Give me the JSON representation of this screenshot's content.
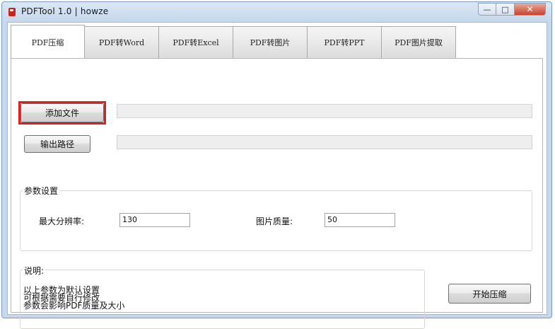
{
  "window": {
    "title": "PDFTool 1.0 | howze",
    "controls": {
      "minimize": "—",
      "maximize": "□",
      "close": "✕"
    }
  },
  "tabs": [
    {
      "label": "PDF压缩",
      "active": true
    },
    {
      "label": "PDF转Word",
      "active": false
    },
    {
      "label": "PDF转Excel",
      "active": false
    },
    {
      "label": "PDF转图片",
      "active": false
    },
    {
      "label": "PDF转PPT",
      "active": false
    },
    {
      "label": "PDF图片提取",
      "active": false
    }
  ],
  "file": {
    "add_button": "添加文件",
    "add_path": "",
    "output_button": "输出路径",
    "output_path": ""
  },
  "params": {
    "group_title": "参数设置",
    "max_resolution_label": "最大分辨率:",
    "max_resolution_value": "130",
    "image_quality_label": "图片质量:",
    "image_quality_value": "50"
  },
  "description": {
    "title": "说明:",
    "lines": [
      "以上参数为默认设置",
      "可根据需要自行修改",
      "参数会影响PDF质量及大小"
    ]
  },
  "actions": {
    "start_button": "开始压缩"
  },
  "colors": {
    "highlight": "#e0201a",
    "title_gradient": "#c6d8ec",
    "close_button": "#c7432d"
  }
}
